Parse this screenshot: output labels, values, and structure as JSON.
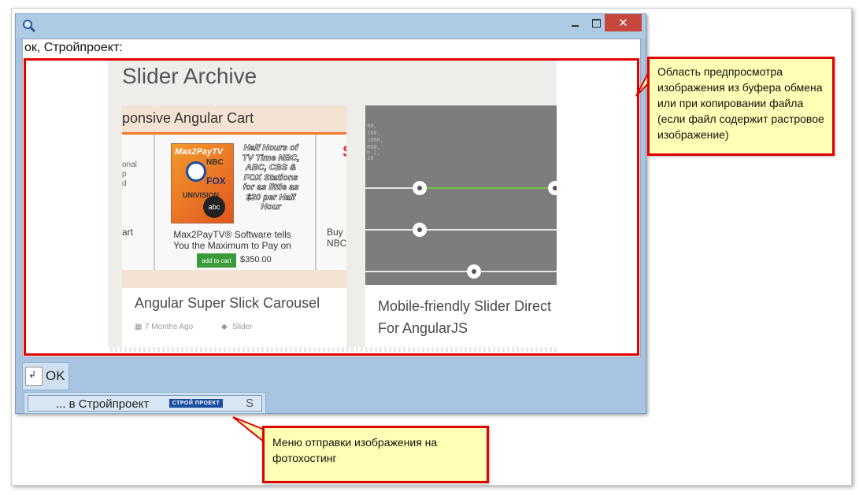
{
  "window": {
    "caption": "ок, Стройпроект:",
    "close_glyph": "✕"
  },
  "preview": {
    "title": "Slider Archive",
    "card1": {
      "header": "ponsive Angular Cart",
      "box_title": "Max2PayTV",
      "logos": {
        "nbc": "NBC",
        "fox": "FOX",
        "abc": "abc",
        "univision": "UNIVISION"
      },
      "promo": "Half Hours of TV Time NBC, ABC, CBS & FOX Stations for as little as $20 per Half Hour",
      "description": "Max2PayTV® Software tells You the Maximum to Pay on",
      "cart_button": "add to cart",
      "price": "$350.00",
      "side_left_text": "onal\np\nd",
      "side_left_word": "art",
      "side_right_text": "Buy\nNBC",
      "name": "Angular Super Slick Carousel",
      "date": "7 Months Ago",
      "tag": "Slider"
    },
    "card2": {
      "code_lines": [
        "80,",
        "160,",
        "1600,",
        "800,",
        "b 1,",
        "10"
      ],
      "name_line1": "Mobile-friendly Slider Direct",
      "name_line2": "For AngularJS"
    }
  },
  "bottom": {
    "ok_label": "OK",
    "send_menu_label": "... в Стройпроект",
    "send_menu_logo": "СТРОЙ ПРОЕКТ",
    "send_menu_key": "S"
  },
  "callouts": {
    "preview_note": "Область предпросмотра изображения из буфера обмена или при копировании файла (если файл содержит растровое изображение)",
    "menu_note": "Меню отправки изображения на фотохостинг"
  },
  "colors": {
    "highlight_red": "#e00000",
    "callout_bg": "#ffffb5",
    "titlebar": "#aecbe6",
    "close_button": "#c7463d"
  }
}
